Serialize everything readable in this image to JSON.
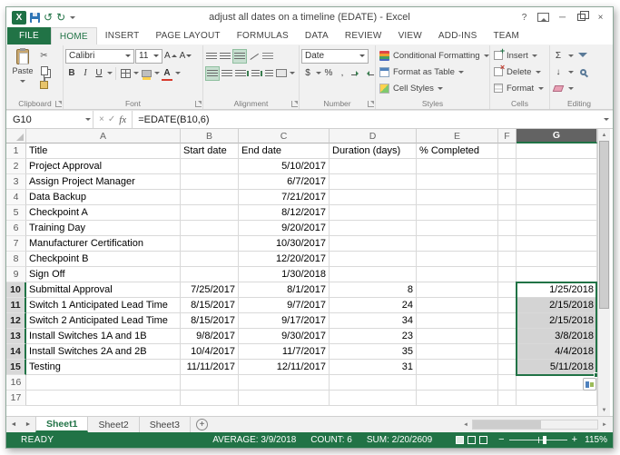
{
  "window": {
    "title": "adjust all dates on a timeline (EDATE) - Excel"
  },
  "icons": {
    "excel_logo": "X",
    "undo": "↺",
    "redo": "↻",
    "help": "?",
    "minimize": "─",
    "close": "×",
    "cut": "✂",
    "autosum": "Σ",
    "fill_down": "↓",
    "cancel": "×",
    "enter": "✓",
    "fx": "fx",
    "font_letter": "A",
    "nav_left": "◄",
    "nav_right": "►",
    "scroll_up": "▲",
    "scroll_down": "▼",
    "zoom_out": "−",
    "zoom_in": "+"
  },
  "ribbon": {
    "tabs": [
      "FILE",
      "HOME",
      "INSERT",
      "PAGE LAYOUT",
      "FORMULAS",
      "DATA",
      "REVIEW",
      "VIEW",
      "ADD-INS",
      "TEAM"
    ],
    "active_tab": "HOME",
    "clipboard": {
      "paste": "Paste",
      "group": "Clipboard"
    },
    "font": {
      "name": "Calibri",
      "size": "11",
      "bold": "B",
      "italic": "I",
      "underline": "U",
      "group": "Font"
    },
    "alignment": {
      "group": "Alignment"
    },
    "number": {
      "format": "Date",
      "currency": "$",
      "percent": "%",
      "comma": ",",
      "group": "Number"
    },
    "styles": {
      "conditional": "Conditional Formatting",
      "table": "Format as Table",
      "cell_styles": "Cell Styles",
      "group": "Styles"
    },
    "cells": {
      "insert": "Insert",
      "delete": "Delete",
      "format": "Format",
      "group": "Cells"
    },
    "editing": {
      "group": "Editing"
    }
  },
  "formula_bar": {
    "cell_ref": "G10",
    "formula": "=EDATE(B10,6)"
  },
  "grid": {
    "columns": [
      "A",
      "B",
      "C",
      "D",
      "E",
      "F",
      "G"
    ],
    "selected_column": "G",
    "active_cell": "G10",
    "selection_range": "G10:G15",
    "rows": [
      {
        "n": "1",
        "cells": [
          "Title",
          "Start date",
          "End date",
          "Duration (days)",
          "% Completed",
          "",
          ""
        ]
      },
      {
        "n": "2",
        "cells": [
          "Project Approval",
          "",
          "5/10/2017",
          "",
          "",
          "",
          ""
        ]
      },
      {
        "n": "3",
        "cells": [
          "Assign Project Manager",
          "",
          "6/7/2017",
          "",
          "",
          "",
          ""
        ]
      },
      {
        "n": "4",
        "cells": [
          "Data Backup",
          "",
          "7/21/2017",
          "",
          "",
          "",
          ""
        ]
      },
      {
        "n": "5",
        "cells": [
          "Checkpoint A",
          "",
          "8/12/2017",
          "",
          "",
          "",
          ""
        ]
      },
      {
        "n": "6",
        "cells": [
          "Training Day",
          "",
          "9/20/2017",
          "",
          "",
          "",
          ""
        ]
      },
      {
        "n": "7",
        "cells": [
          "Manufacturer Certification",
          "",
          "10/30/2017",
          "",
          "",
          "",
          ""
        ]
      },
      {
        "n": "8",
        "cells": [
          "Checkpoint B",
          "",
          "12/20/2017",
          "",
          "",
          "",
          ""
        ]
      },
      {
        "n": "9",
        "cells": [
          "Sign Off",
          "",
          "1/30/2018",
          "",
          "",
          "",
          ""
        ]
      },
      {
        "n": "10",
        "cells": [
          "Submittal Approval",
          "7/25/2017",
          "8/1/2017",
          "8",
          "",
          "",
          "1/25/2018"
        ]
      },
      {
        "n": "11",
        "cells": [
          "Switch 1 Anticipated Lead Time",
          "8/15/2017",
          "9/7/2017",
          "24",
          "",
          "",
          "2/15/2018"
        ]
      },
      {
        "n": "12",
        "cells": [
          "Switch 2 Anticipated Lead Time",
          "8/15/2017",
          "9/17/2017",
          "34",
          "",
          "",
          "2/15/2018"
        ]
      },
      {
        "n": "13",
        "cells": [
          "Install Switches 1A and 1B",
          "9/8/2017",
          "9/30/2017",
          "23",
          "",
          "",
          "3/8/2018"
        ]
      },
      {
        "n": "14",
        "cells": [
          "Install Switches 2A and 2B",
          "10/4/2017",
          "11/7/2017",
          "35",
          "",
          "",
          "4/4/2018"
        ]
      },
      {
        "n": "15",
        "cells": [
          "Testing",
          "11/11/2017",
          "12/11/2017",
          "31",
          "",
          "",
          "5/11/2018"
        ]
      },
      {
        "n": "16",
        "cells": [
          "",
          "",
          "",
          "",
          "",
          "",
          ""
        ]
      },
      {
        "n": "17",
        "cells": [
          "",
          "",
          "",
          "",
          "",
          "",
          ""
        ]
      }
    ]
  },
  "sheet_tabs": {
    "tabs": [
      "Sheet1",
      "Sheet2",
      "Sheet3"
    ],
    "active": "Sheet1",
    "add": "+"
  },
  "status_bar": {
    "mode": "READY",
    "average": "AVERAGE: 3/9/2018",
    "count": "COUNT: 6",
    "sum": "SUM: 2/20/2609",
    "zoom": "115%"
  },
  "colors": {
    "accent": "#217346",
    "selection_fill": "#d4d4d4"
  }
}
